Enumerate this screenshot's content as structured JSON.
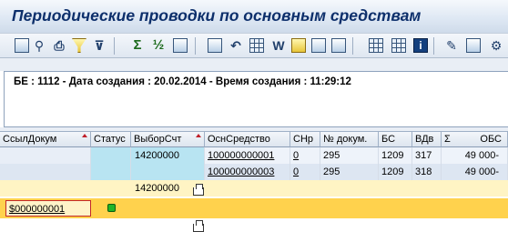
{
  "window": {
    "title": "Периодические проводки по основным средствам"
  },
  "toolbar": {
    "icons": [
      "details-icon",
      "find-icon",
      "print-icon",
      "filter-set-icon",
      "filter-icon",
      "sum-icon",
      "subtotal-icon",
      "document-icon",
      "export-icon",
      "back-icon",
      "spreadsheet-icon",
      "word-icon",
      "graphic-icon",
      "layout-icon",
      "layout-select-icon",
      "grid-icon",
      "grid-alt-icon",
      "abc-analysis-icon",
      "info-icon",
      "edit-icon",
      "settings-icon"
    ]
  },
  "header": {
    "text": "БЕ : 1112 - Дата создания : 20.02.2014 - Время создания : 11:29:12"
  },
  "table": {
    "columns": [
      "СсылДокум",
      "Статус",
      "ВыборСчт",
      "ОснСредство",
      "СНр",
      "№ докум.",
      "БС",
      "ВДв",
      "Σ",
      "ОБС"
    ],
    "rows": [
      {
        "vybor": "14200000",
        "osn": "100000000001",
        "snr": "0",
        "doc": "295",
        "bs": "1209",
        "vdv": "317",
        "obs": "49 000-"
      },
      {
        "vybor": "",
        "osn": "100000000003",
        "snr": "0",
        "doc": "295",
        "bs": "1209",
        "vdv": "318",
        "obs": "49 000-"
      }
    ],
    "subtotal": {
      "vybor": "14200000"
    },
    "group": {
      "ssyl": "$000000001",
      "status_color": "#21b427"
    }
  }
}
